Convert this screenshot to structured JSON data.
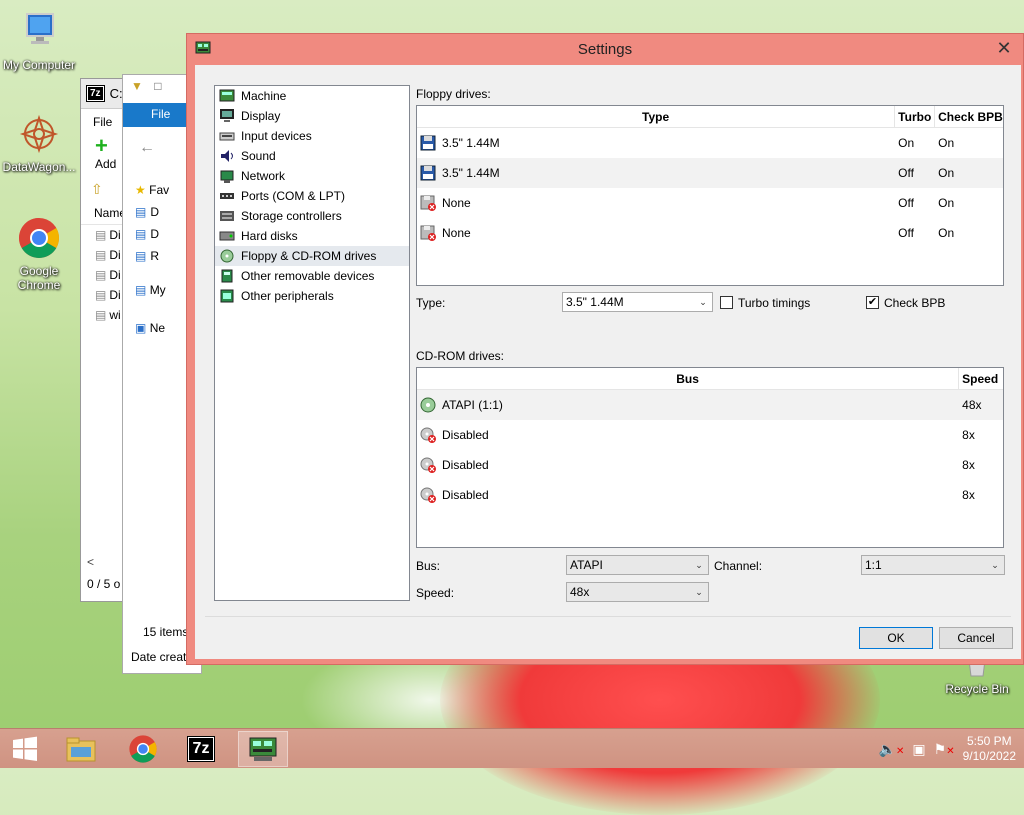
{
  "desktop": {
    "icons": [
      {
        "label": "My Computer"
      },
      {
        "label": "DataWagon..."
      },
      {
        "label": "Google Chrome"
      },
      {
        "label": "Recycle Bin"
      }
    ]
  },
  "bg_7z": {
    "title": "C:",
    "menu_file": "File",
    "add_label": "Add",
    "col_name": "Name",
    "rows": [
      "Di",
      "Di",
      "Di",
      "Di",
      "wi"
    ],
    "status": "0 / 5 o"
  },
  "bg_explorer": {
    "file_tab": "File",
    "nav_favorites": "Fav",
    "nav_items": [
      "D",
      "D",
      "R"
    ],
    "nav_my": "My",
    "nav_network": "Ne",
    "items_count": "15 items",
    "date_created": "Date creat"
  },
  "settings": {
    "title": "Settings",
    "categories": [
      {
        "label": "Machine",
        "icon": "machine-icon"
      },
      {
        "label": "Display",
        "icon": "display-icon"
      },
      {
        "label": "Input devices",
        "icon": "input-devices-icon"
      },
      {
        "label": "Sound",
        "icon": "sound-icon"
      },
      {
        "label": "Network",
        "icon": "network-icon"
      },
      {
        "label": "Ports (COM & LPT)",
        "icon": "ports-icon"
      },
      {
        "label": "Storage controllers",
        "icon": "storage-icon"
      },
      {
        "label": "Hard disks",
        "icon": "hard-disk-icon"
      },
      {
        "label": "Floppy & CD-ROM drives",
        "icon": "floppy-cdrom-icon"
      },
      {
        "label": "Other removable devices",
        "icon": "removable-icon"
      },
      {
        "label": "Other peripherals",
        "icon": "peripherals-icon"
      }
    ],
    "selected_category": "Floppy & CD-ROM drives",
    "floppy": {
      "section_label": "Floppy drives:",
      "columns": [
        "Type",
        "Turbo",
        "Check BPB"
      ],
      "rows": [
        {
          "type": "3.5\" 1.44M",
          "turbo": "On",
          "check_bpb": "On",
          "icon": "floppy-icon"
        },
        {
          "type": "3.5\" 1.44M",
          "turbo": "Off",
          "check_bpb": "On",
          "icon": "floppy-icon"
        },
        {
          "type": "None",
          "turbo": "Off",
          "check_bpb": "On",
          "icon": "floppy-disabled-icon"
        },
        {
          "type": "None",
          "turbo": "Off",
          "check_bpb": "On",
          "icon": "floppy-disabled-icon"
        }
      ],
      "type_label": "Type:",
      "type_value": "3.5\" 1.44M",
      "turbo_label": "Turbo timings",
      "turbo_checked": false,
      "checkbpb_label": "Check BPB",
      "checkbpb_checked": true
    },
    "cdrom": {
      "section_label": "CD-ROM drives:",
      "columns": [
        "Bus",
        "Speed"
      ],
      "rows": [
        {
          "bus": "ATAPI (1:1)",
          "speed": "48x",
          "icon": "cdrom-icon"
        },
        {
          "bus": "Disabled",
          "speed": "8x",
          "icon": "cdrom-disabled-icon"
        },
        {
          "bus": "Disabled",
          "speed": "8x",
          "icon": "cdrom-disabled-icon"
        },
        {
          "bus": "Disabled",
          "speed": "8x",
          "icon": "cdrom-disabled-icon"
        }
      ],
      "bus_label": "Bus:",
      "bus_value": "ATAPI",
      "channel_label": "Channel:",
      "channel_value": "1:1",
      "speed_label": "Speed:",
      "speed_value": "48x"
    },
    "ok_label": "OK",
    "cancel_label": "Cancel"
  },
  "taskbar": {
    "time": "5:50 PM",
    "date": "9/10/2022",
    "apps": [
      "file-explorer",
      "chrome",
      "7zip",
      "86box-settings"
    ]
  },
  "colors": {
    "dialog_frame": "#f08a80",
    "taskbar": "#cf9382",
    "selection": "#e5e9ee"
  }
}
